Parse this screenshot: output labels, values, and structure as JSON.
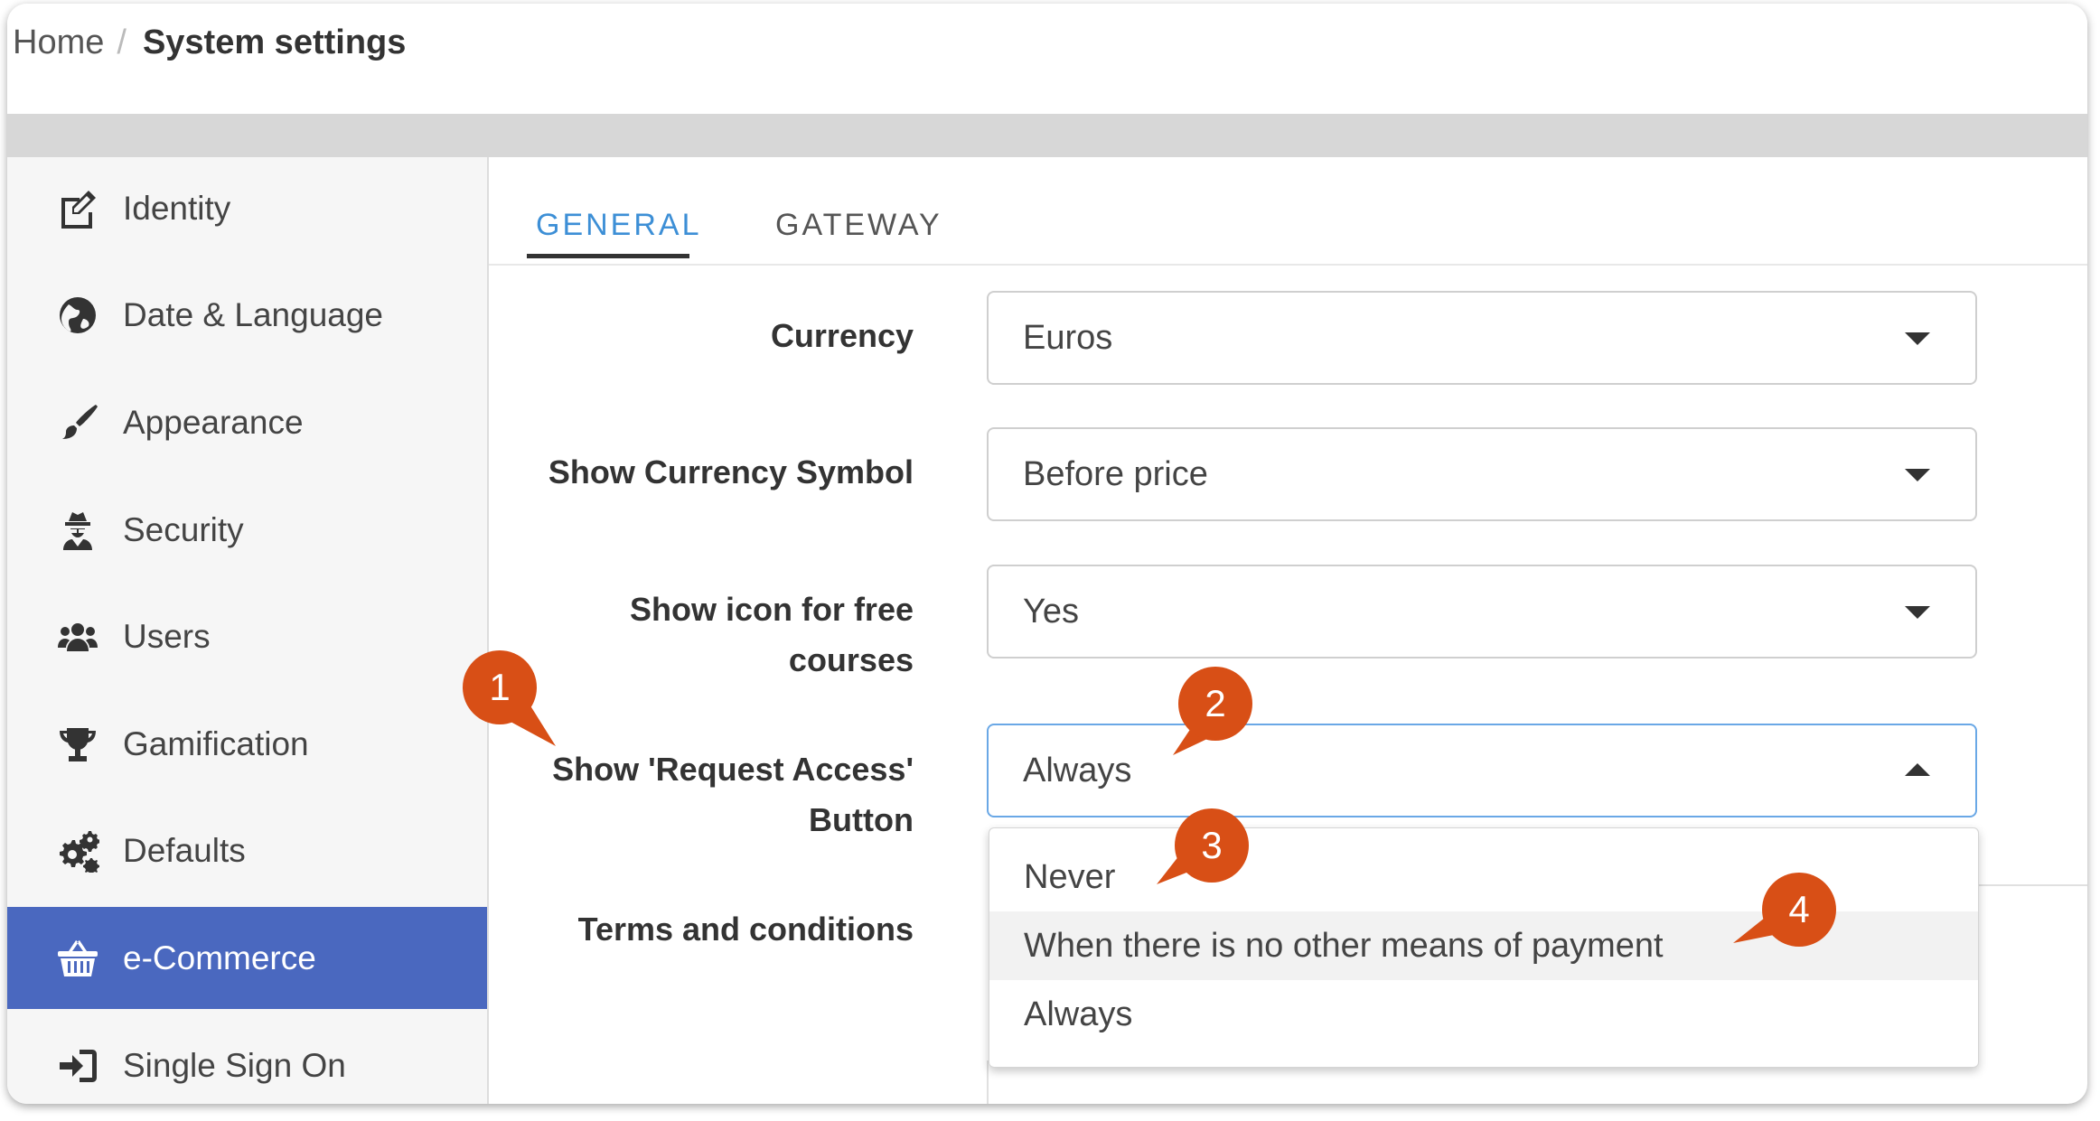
{
  "breadcrumb": {
    "home": "Home",
    "separator": "/",
    "current": "System settings"
  },
  "sidebar": {
    "items": [
      {
        "label": "Identity",
        "icon": "edit-icon"
      },
      {
        "label": "Date & Language",
        "icon": "globe-icon"
      },
      {
        "label": "Appearance",
        "icon": "paintbrush-icon"
      },
      {
        "label": "Security",
        "icon": "user-secret-icon"
      },
      {
        "label": "Users",
        "icon": "users-icon"
      },
      {
        "label": "Gamification",
        "icon": "trophy-icon"
      },
      {
        "label": "Defaults",
        "icon": "cogs-icon"
      },
      {
        "label": "e-Commerce",
        "icon": "shopping-basket-icon",
        "active": true
      },
      {
        "label": "Single Sign On",
        "icon": "sign-in-icon"
      }
    ]
  },
  "tabs": [
    {
      "label": "GENERAL",
      "active": true
    },
    {
      "label": "GATEWAY",
      "active": false
    }
  ],
  "form": {
    "currency": {
      "label": "Currency",
      "value": "Euros"
    },
    "currency_symbol": {
      "label": "Show Currency Symbol",
      "value": "Before price"
    },
    "free_icon": {
      "label_line1": "Show icon for free",
      "label_line2": "courses",
      "value": "Yes"
    },
    "request_access": {
      "label_line1": "Show 'Request Access'",
      "label_line2": "Button",
      "value": "Always"
    },
    "terms": {
      "label": "Terms and conditions"
    }
  },
  "dropdown": {
    "options": [
      "Never",
      "When there is no other means of payment",
      "Always"
    ],
    "hovered_index": 1
  },
  "callouts": [
    "1",
    "2",
    "3",
    "4"
  ],
  "colors": {
    "active_sidebar": "#4a68bf",
    "active_tab": "#3d8fd6",
    "callout": "#d84f16",
    "select_focus_border": "#6aa8e6"
  }
}
